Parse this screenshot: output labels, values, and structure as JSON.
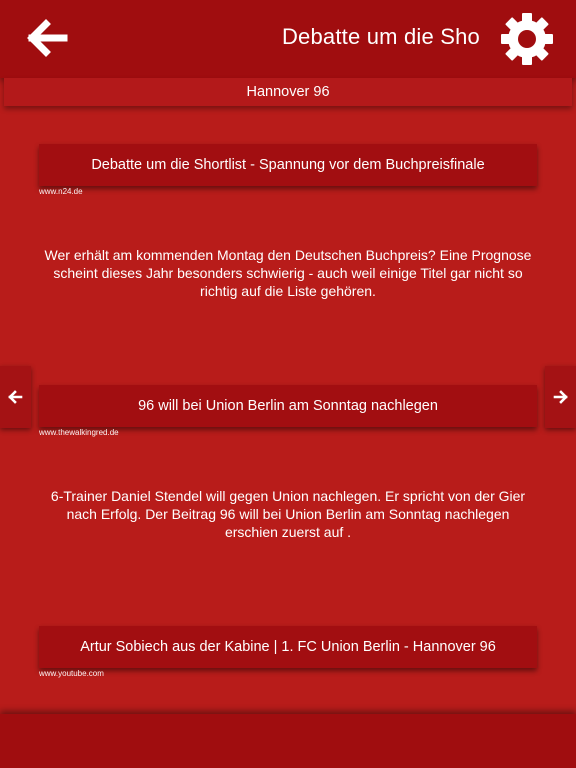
{
  "header": {
    "title": "Debatte um die Sho",
    "back_icon": "arrow-left-icon",
    "settings_icon": "gear-icon"
  },
  "subheader": {
    "label": "Hannover 96"
  },
  "articles": [
    {
      "title": "Debatte um die Shortlist - Spannung vor dem Buchpreisfinale",
      "source": "www.n24.de",
      "description": "Wer erhält am kommenden Montag den Deutschen Buchpreis? Eine Prognose scheint dieses Jahr besonders schwierig - auch weil einige Titel gar nicht so richtig auf die Liste gehören."
    },
    {
      "title": "96 will bei Union Berlin am Sonntag nachlegen",
      "source": "www.thewalkingred.de",
      "description": "6-Trainer Daniel Stendel will gegen Union nachlegen. Er spricht von der Gier nach Erfolg. Der Beitrag 96 will bei Union Berlin am Sonntag nachlegen erschien zuerst auf ."
    },
    {
      "title": "Artur Sobiech aus der Kabine | 1. FC Union Berlin - Hannover 96",
      "source": "www.youtube.com",
      "description": ""
    }
  ],
  "nav": {
    "prev_icon": "arrow-left-icon",
    "next_icon": "arrow-right-icon"
  },
  "colors": {
    "background": "#b81c1a",
    "bar": "#a00d0f",
    "text": "#ffffff"
  }
}
